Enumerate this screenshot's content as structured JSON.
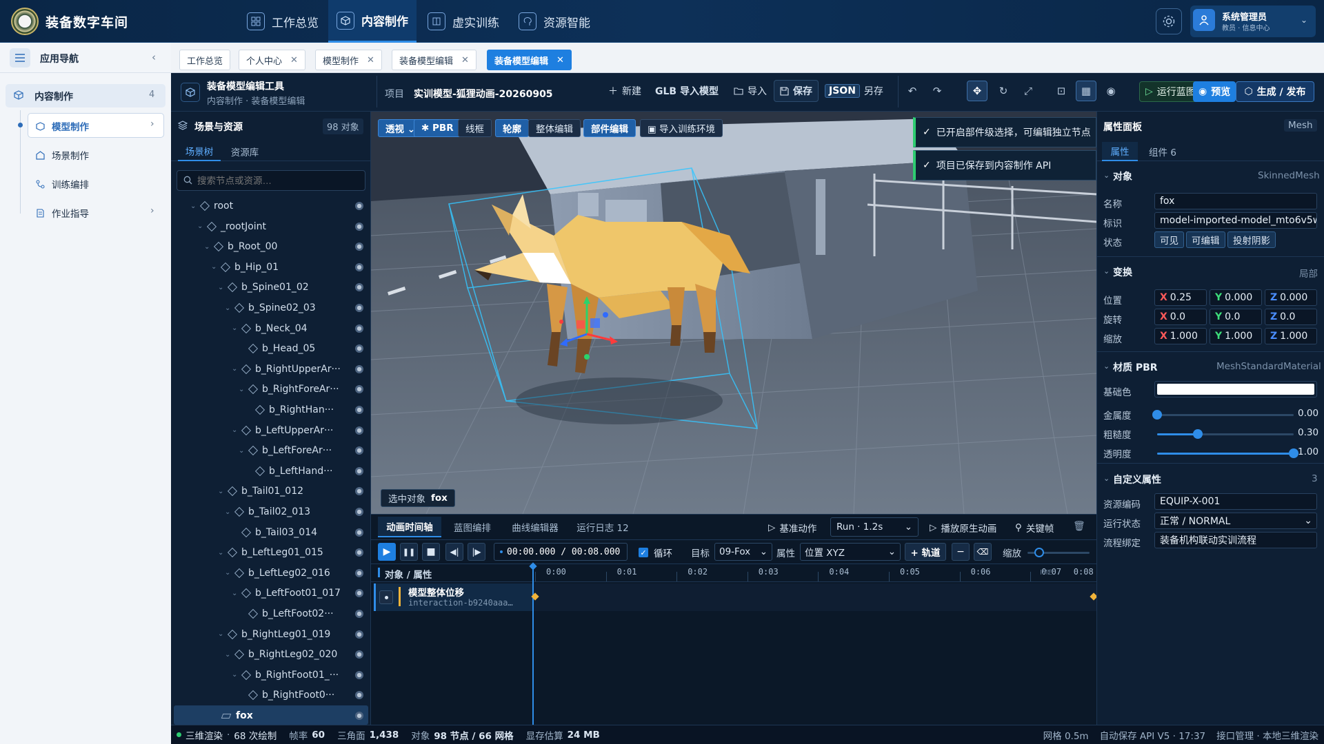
{
  "app": {
    "title": "装备数字车间"
  },
  "topnav": [
    {
      "label": "工作总览",
      "icon": "dashboard-icon"
    },
    {
      "label": "内容制作",
      "icon": "cube-icon",
      "active": true
    },
    {
      "label": "虚实训练",
      "icon": "book-icon"
    },
    {
      "label": "资源智能",
      "icon": "brain-icon"
    }
  ],
  "user": {
    "name": "系统管理员",
    "role": "教员 · 信息中心"
  },
  "leftnav": {
    "header": "应用导航",
    "group": {
      "label": "内容制作",
      "count": "4"
    },
    "items": [
      {
        "label": "模型制作",
        "active": true,
        "icon": "cube-icon"
      },
      {
        "label": "场景制作",
        "icon": "scene-icon"
      },
      {
        "label": "训练编排",
        "icon": "flow-icon"
      },
      {
        "label": "作业指导",
        "icon": "document-icon"
      }
    ]
  },
  "doc_tabs": [
    {
      "label": "工作总览",
      "closable": false
    },
    {
      "label": "个人中心",
      "closable": true
    },
    {
      "label": "模型制作",
      "closable": true
    },
    {
      "label": "装备模型编辑",
      "closable": true
    },
    {
      "label": "装备模型编辑",
      "closable": true,
      "active": true
    }
  ],
  "toolbar": {
    "tool_title": "装备模型编辑工具",
    "breadcrumb": "内容制作 · 装备模型编辑",
    "project_label": "项目",
    "project_name": "实训模型-狐狸动画-20260905",
    "new": "新建",
    "glb_import": "GLB 导入模型",
    "import": "导入",
    "save": "保存",
    "json": "JSON",
    "save_as": "另存",
    "run_blueprint": "运行蓝图",
    "preview": "预览",
    "generate": "生成 / 发布"
  },
  "scene": {
    "title": "场景与资源",
    "count": "98 对象",
    "tabs": [
      "场景树",
      "资源库"
    ],
    "search_placeholder": "搜索节点或资源…",
    "nodes": [
      {
        "label": "root",
        "depth": 0
      },
      {
        "label": "_rootJoint",
        "depth": 1
      },
      {
        "label": "b_Root_00",
        "depth": 2
      },
      {
        "label": "b_Hip_01",
        "depth": 3
      },
      {
        "label": "b_Spine01_02",
        "depth": 4
      },
      {
        "label": "b_Spine02_03",
        "depth": 5
      },
      {
        "label": "b_Neck_04",
        "depth": 6
      },
      {
        "label": "b_Head_05",
        "depth": 7,
        "leaf": true
      },
      {
        "label": "b_RightUpperAr···",
        "depth": 6
      },
      {
        "label": "b_RightForeAr···",
        "depth": 7
      },
      {
        "label": "b_RightHan···",
        "depth": 8,
        "leaf": true
      },
      {
        "label": "b_LeftUpperAr···",
        "depth": 6
      },
      {
        "label": "b_LeftForeAr···",
        "depth": 7
      },
      {
        "label": "b_LeftHand···",
        "depth": 8,
        "leaf": true
      },
      {
        "label": "b_Tail01_012",
        "depth": 4
      },
      {
        "label": "b_Tail02_013",
        "depth": 5
      },
      {
        "label": "b_Tail03_014",
        "depth": 6,
        "leaf": true
      },
      {
        "label": "b_LeftLeg01_015",
        "depth": 4
      },
      {
        "label": "b_LeftLeg02_016",
        "depth": 5
      },
      {
        "label": "b_LeftFoot01_017",
        "depth": 6
      },
      {
        "label": "b_LeftFoot02···",
        "depth": 7,
        "leaf": true
      },
      {
        "label": "b_RightLeg01_019",
        "depth": 4
      },
      {
        "label": "b_RightLeg02_020",
        "depth": 5
      },
      {
        "label": "b_RightFoot01_···",
        "depth": 6
      },
      {
        "label": "b_RightFoot0···",
        "depth": 7,
        "leaf": true
      },
      {
        "label": "fox",
        "depth": 3,
        "mesh": true,
        "selected": true
      }
    ]
  },
  "viewport": {
    "buttons": [
      {
        "label": "透视 ⌄",
        "on": true
      },
      {
        "label": "✱ PBR",
        "on": true
      },
      {
        "label": "线框"
      },
      {
        "label": "轮廓",
        "on": true
      },
      {
        "label": "整体编辑"
      },
      {
        "label": "部件编辑",
        "on": true
      },
      {
        "label": "▣ 导入训练环境"
      }
    ],
    "toasts": [
      "已开启部件级选择，可编辑独立节点",
      "项目已保存到内容制作 API"
    ],
    "selected_label": "选中对象",
    "selected_name": "fox"
  },
  "timeline": {
    "tabs": [
      "动画时间轴",
      "蓝图编排",
      "曲线编辑器",
      "运行日志 12"
    ],
    "base_action": "基准动作",
    "clip": "Run · 1.2s",
    "play_original": "播放原生动画",
    "keyframe": "关键帧",
    "time": "00:00.000 / 00:08.000",
    "loop": "循环",
    "target_label": "目标",
    "target": "09-Fox",
    "attr_label": "属性",
    "attr": "位置 XYZ",
    "add_track": "+ 轨道",
    "zoom": "缩放",
    "col_header": "对象 / 属性",
    "ticks": [
      "0:00",
      "0:01",
      "0:02",
      "0:03",
      "0:04",
      "0:05",
      "0:06",
      "0:07",
      "0:08"
    ],
    "ime": "IME",
    "track": {
      "name": "模型整体位移",
      "id": "interaction-b9240aaa…"
    }
  },
  "props": {
    "title": "属性面板",
    "type": "Mesh",
    "tabs": [
      "属性",
      "组件 6"
    ],
    "object": {
      "title": "对象",
      "kind": "SkinnedMesh",
      "name_label": "名称",
      "name": "fox",
      "id_label": "标识",
      "id": "model-imported-model_mto6v5w",
      "state_label": "状态",
      "states": [
        "可见",
        "可编辑",
        "投射阴影"
      ]
    },
    "transform": {
      "title": "变换",
      "space": "局部",
      "rows": [
        {
          "label": "位置",
          "x": "0.25",
          "y": "0.000",
          "z": "0.000"
        },
        {
          "label": "旋转",
          "x": "0.0",
          "y": "0.0",
          "z": "0.0"
        },
        {
          "label": "缩放",
          "x": "1.000",
          "y": "1.000",
          "z": "1.000"
        }
      ]
    },
    "material": {
      "title": "材质 PBR",
      "kind": "MeshStandardMaterial",
      "base_label": "基础色",
      "base_color": "#ffffff",
      "sliders": [
        {
          "label": "金属度",
          "value": "0.00",
          "frac": 0.0
        },
        {
          "label": "粗糙度",
          "value": "0.30",
          "frac": 0.3
        },
        {
          "label": "透明度",
          "value": "1.00",
          "frac": 1.0
        }
      ]
    },
    "custom": {
      "title": "自定义属性",
      "count": "3",
      "rows": [
        {
          "label": "资源编码",
          "value": "EQUIP-X-001"
        },
        {
          "label": "运行状态",
          "value": "正常 / NORMAL",
          "select": true
        },
        {
          "label": "流程绑定",
          "value": "装备机构联动实训流程"
        }
      ]
    }
  },
  "status": {
    "render": "三维渲染",
    "draws": "68 次绘制",
    "fps_label": "帧率",
    "fps": "60",
    "tri_label": "三角面",
    "tri": "1,438",
    "obj_label": "对象",
    "obj": "98 节点 / 66 网格",
    "mem_label": "显存估算",
    "mem": "24 MB",
    "grid": "网格 0.5m",
    "autosave": "自动保存 API V5 · 17:37",
    "api": "接口管理 · 本地三维渲染"
  },
  "colors": {
    "accent": "#1e7fe0",
    "success": "#2ecc71",
    "header": "#0d3058",
    "panel": "#0e1f34"
  }
}
